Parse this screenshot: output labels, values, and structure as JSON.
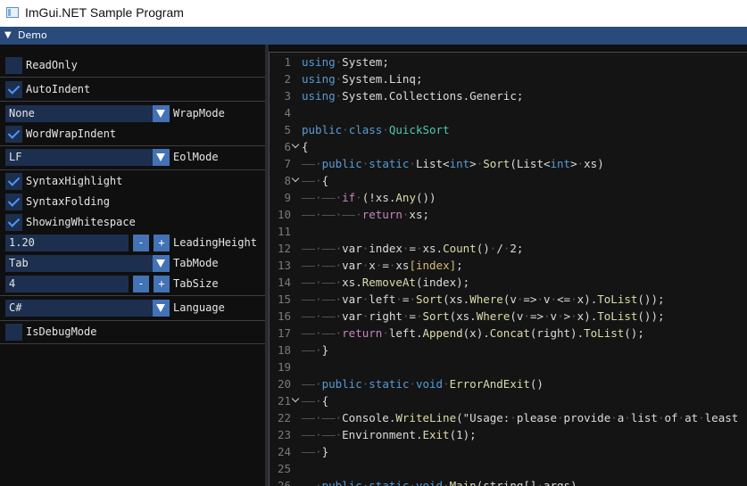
{
  "window": {
    "title": "ImGui.NET Sample Program",
    "icon": "app-window-icon"
  },
  "imgui_window": {
    "title": "Demo",
    "collapse_icon": "triangle-down-icon"
  },
  "options": {
    "read_only": {
      "label": "ReadOnly",
      "checked": false
    },
    "auto_indent": {
      "label": "AutoIndent",
      "checked": true
    },
    "wrap_mode": {
      "label": "WrapMode",
      "value": "None"
    },
    "word_wrap_indent": {
      "label": "WordWrapIndent",
      "checked": true
    },
    "eol_mode": {
      "label": "EolMode",
      "value": "LF"
    },
    "syntax_highlight": {
      "label": "SyntaxHighlight",
      "checked": true
    },
    "syntax_folding": {
      "label": "SyntaxFolding",
      "checked": true
    },
    "showing_whitespace": {
      "label": "ShowingWhitespace",
      "checked": true
    },
    "leading_height": {
      "label": "LeadingHeight",
      "value": "1.20",
      "minus": "-",
      "plus": "+"
    },
    "tab_mode": {
      "label": "TabMode",
      "value": "Tab"
    },
    "tab_size": {
      "label": "TabSize",
      "value": "4",
      "minus": "-",
      "plus": "+"
    },
    "language": {
      "label": "Language",
      "value": "C#"
    },
    "is_debug_mode": {
      "label": "IsDebugMode",
      "checked": false
    }
  },
  "editor": {
    "lines": [
      {
        "n": "1",
        "fold": false,
        "t": [
          [
            "kw",
            "using"
          ],
          [
            "ws",
            "·"
          ],
          [
            "tx",
            "System;"
          ]
        ]
      },
      {
        "n": "2",
        "fold": false,
        "t": [
          [
            "kw",
            "using"
          ],
          [
            "ws",
            "·"
          ],
          [
            "tx",
            "System.Linq;"
          ]
        ]
      },
      {
        "n": "3",
        "fold": false,
        "t": [
          [
            "kw",
            "using"
          ],
          [
            "ws",
            "·"
          ],
          [
            "tx",
            "System.Collections.Generic;"
          ]
        ]
      },
      {
        "n": "4",
        "fold": false,
        "t": []
      },
      {
        "n": "5",
        "fold": false,
        "t": [
          [
            "kw",
            "public"
          ],
          [
            "ws",
            "·"
          ],
          [
            "kw",
            "class"
          ],
          [
            "ws",
            "·"
          ],
          [
            "ty",
            "QuickSort"
          ]
        ]
      },
      {
        "n": "6",
        "fold": true,
        "t": [
          [
            "tx",
            "{"
          ]
        ]
      },
      {
        "n": "7",
        "fold": false,
        "t": [
          [
            "ws",
            "——·"
          ],
          [
            "kw",
            "public"
          ],
          [
            "ws",
            "·"
          ],
          [
            "kw",
            "static"
          ],
          [
            "ws",
            "·"
          ],
          [
            "tx",
            "List<"
          ],
          [
            "kw",
            "int"
          ],
          [
            "tx",
            ">"
          ],
          [
            "ws",
            "·"
          ],
          [
            "fn",
            "Sort"
          ],
          [
            "tx",
            "(List<"
          ],
          [
            "kw",
            "int"
          ],
          [
            "tx",
            ">"
          ],
          [
            "ws",
            "·"
          ],
          [
            "tx",
            "xs)"
          ]
        ]
      },
      {
        "n": "8",
        "fold": true,
        "t": [
          [
            "ws",
            "——·"
          ],
          [
            "tx",
            "{"
          ]
        ]
      },
      {
        "n": "9",
        "fold": false,
        "t": [
          [
            "ws",
            "——·——·"
          ],
          [
            "ct",
            "if"
          ],
          [
            "ws",
            "·"
          ],
          [
            "tx",
            "(!xs."
          ],
          [
            "fn",
            "Any"
          ],
          [
            "tx",
            "())"
          ]
        ]
      },
      {
        "n": "10",
        "fold": false,
        "t": [
          [
            "ws",
            "——·——·——·"
          ],
          [
            "ct",
            "return"
          ],
          [
            "ws",
            "·"
          ],
          [
            "tx",
            "xs;"
          ]
        ]
      },
      {
        "n": "11",
        "fold": false,
        "t": []
      },
      {
        "n": "12",
        "fold": false,
        "t": [
          [
            "ws",
            "——·——·"
          ],
          [
            "tx",
            "var"
          ],
          [
            "ws",
            "·"
          ],
          [
            "tx",
            "index"
          ],
          [
            "ws",
            "·"
          ],
          [
            "tx",
            "="
          ],
          [
            "ws",
            "·"
          ],
          [
            "tx",
            "xs."
          ],
          [
            "fn",
            "Count"
          ],
          [
            "tx",
            "()"
          ],
          [
            "ws",
            "·"
          ],
          [
            "tx",
            "/"
          ],
          [
            "ws",
            "·"
          ],
          [
            "tx",
            "2;"
          ]
        ]
      },
      {
        "n": "13",
        "fold": false,
        "t": [
          [
            "ws",
            "——·——·"
          ],
          [
            "tx",
            "var"
          ],
          [
            "ws",
            "·"
          ],
          [
            "tx",
            "x"
          ],
          [
            "ws",
            "·"
          ],
          [
            "tx",
            "="
          ],
          [
            "ws",
            "·"
          ],
          [
            "tx",
            "xs"
          ],
          [
            "ix",
            "[index]"
          ],
          [
            "tx",
            ";"
          ]
        ]
      },
      {
        "n": "14",
        "fold": false,
        "t": [
          [
            "ws",
            "——·——·"
          ],
          [
            "tx",
            "xs."
          ],
          [
            "fn",
            "RemoveAt"
          ],
          [
            "tx",
            "(index);"
          ]
        ]
      },
      {
        "n": "15",
        "fold": false,
        "t": [
          [
            "ws",
            "——·——·"
          ],
          [
            "tx",
            "var"
          ],
          [
            "ws",
            "·"
          ],
          [
            "tx",
            "left"
          ],
          [
            "ws",
            "·"
          ],
          [
            "tx",
            "="
          ],
          [
            "ws",
            "·"
          ],
          [
            "fn",
            "Sort"
          ],
          [
            "tx",
            "(xs."
          ],
          [
            "fn",
            "Where"
          ],
          [
            "tx",
            "(v"
          ],
          [
            "ws",
            "·"
          ],
          [
            "tx",
            "=>"
          ],
          [
            "ws",
            "·"
          ],
          [
            "tx",
            "v"
          ],
          [
            "ws",
            "·"
          ],
          [
            "tx",
            "<="
          ],
          [
            "ws",
            "·"
          ],
          [
            "tx",
            "x)."
          ],
          [
            "fn",
            "ToList"
          ],
          [
            "tx",
            "());"
          ]
        ]
      },
      {
        "n": "16",
        "fold": false,
        "t": [
          [
            "ws",
            "——·——·"
          ],
          [
            "tx",
            "var"
          ],
          [
            "ws",
            "·"
          ],
          [
            "tx",
            "right"
          ],
          [
            "ws",
            "·"
          ],
          [
            "tx",
            "="
          ],
          [
            "ws",
            "·"
          ],
          [
            "fn",
            "Sort"
          ],
          [
            "tx",
            "(xs."
          ],
          [
            "fn",
            "Where"
          ],
          [
            "tx",
            "(v"
          ],
          [
            "ws",
            "·"
          ],
          [
            "tx",
            "=>"
          ],
          [
            "ws",
            "·"
          ],
          [
            "tx",
            "v"
          ],
          [
            "ws",
            "·"
          ],
          [
            "tx",
            ">"
          ],
          [
            "ws",
            "·"
          ],
          [
            "tx",
            "x)."
          ],
          [
            "fn",
            "ToList"
          ],
          [
            "tx",
            "());"
          ]
        ]
      },
      {
        "n": "17",
        "fold": false,
        "t": [
          [
            "ws",
            "——·——·"
          ],
          [
            "ct",
            "return"
          ],
          [
            "ws",
            "·"
          ],
          [
            "tx",
            "left."
          ],
          [
            "fn",
            "Append"
          ],
          [
            "tx",
            "(x)."
          ],
          [
            "fn",
            "Concat"
          ],
          [
            "tx",
            "(right)."
          ],
          [
            "fn",
            "ToList"
          ],
          [
            "tx",
            "();"
          ]
        ]
      },
      {
        "n": "18",
        "fold": false,
        "t": [
          [
            "ws",
            "——·"
          ],
          [
            "tx",
            "}"
          ]
        ]
      },
      {
        "n": "19",
        "fold": false,
        "t": []
      },
      {
        "n": "20",
        "fold": false,
        "t": [
          [
            "ws",
            "——·"
          ],
          [
            "kw",
            "public"
          ],
          [
            "ws",
            "·"
          ],
          [
            "kw",
            "static"
          ],
          [
            "ws",
            "·"
          ],
          [
            "kw",
            "void"
          ],
          [
            "ws",
            "·"
          ],
          [
            "fn",
            "ErrorAndExit"
          ],
          [
            "tx",
            "()"
          ]
        ]
      },
      {
        "n": "21",
        "fold": true,
        "t": [
          [
            "ws",
            "——·"
          ],
          [
            "tx",
            "{"
          ]
        ]
      },
      {
        "n": "22",
        "fold": false,
        "t": [
          [
            "ws",
            "——·——·"
          ],
          [
            "tx",
            "Console."
          ],
          [
            "fn",
            "WriteLine"
          ],
          [
            "tx",
            "(\"Usage:"
          ],
          [
            "ws",
            "·"
          ],
          [
            "tx",
            "please"
          ],
          [
            "ws",
            "·"
          ],
          [
            "tx",
            "provide"
          ],
          [
            "ws",
            "·"
          ],
          [
            "tx",
            "a"
          ],
          [
            "ws",
            "·"
          ],
          [
            "tx",
            "list"
          ],
          [
            "ws",
            "·"
          ],
          [
            "tx",
            "of"
          ],
          [
            "ws",
            "·"
          ],
          [
            "tx",
            "at"
          ],
          [
            "ws",
            "·"
          ],
          [
            "tx",
            "least"
          ]
        ]
      },
      {
        "n": "23",
        "fold": false,
        "t": [
          [
            "ws",
            "——·——·"
          ],
          [
            "tx",
            "Environment."
          ],
          [
            "fn",
            "Exit"
          ],
          [
            "tx",
            "(1);"
          ]
        ]
      },
      {
        "n": "24",
        "fold": false,
        "t": [
          [
            "ws",
            "——·"
          ],
          [
            "tx",
            "}"
          ]
        ]
      },
      {
        "n": "25",
        "fold": false,
        "t": []
      },
      {
        "n": "26",
        "fold": false,
        "t": [
          [
            "ws",
            "——·"
          ],
          [
            "kw",
            "public"
          ],
          [
            "ws",
            "·"
          ],
          [
            "kw",
            "static"
          ],
          [
            "ws",
            "·"
          ],
          [
            "kw",
            "void"
          ],
          [
            "ws",
            "·"
          ],
          [
            "fn",
            "Main"
          ],
          [
            "tx",
            "(string[]"
          ],
          [
            "ws",
            "·"
          ],
          [
            "tx",
            "args)"
          ]
        ]
      }
    ]
  },
  "colors": {
    "kw": "#569cd6",
    "ty": "#4ec9b0",
    "fn": "#dcdcaa",
    "ct": "#c586c0",
    "tx": "#dcdcdc",
    "ws": "#5a5a5a",
    "ix": "#d7ba7d",
    "accent": "#4372b5",
    "frame": "#1d2f4f"
  }
}
